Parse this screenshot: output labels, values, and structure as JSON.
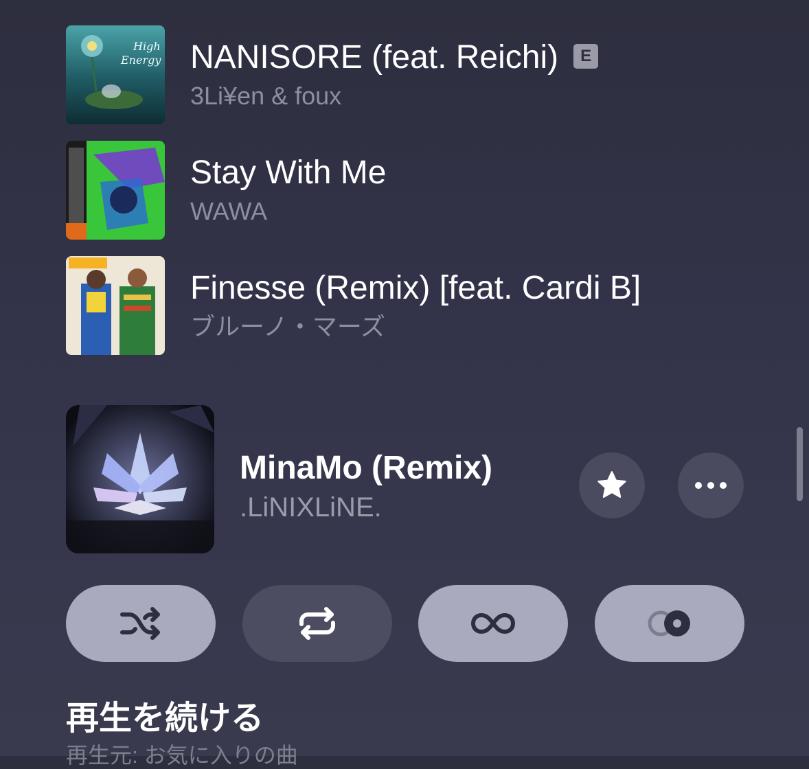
{
  "queue": [
    {
      "title": "NANISORE (feat. Reichi)",
      "artist": "3Li¥en & foux",
      "explicit": "E",
      "art_colors": [
        "#1f5a63",
        "#2d7b5a"
      ]
    },
    {
      "title": "Stay With Me",
      "artist": "WAWA",
      "explicit": "",
      "art_colors": [
        "#39c63a",
        "#7a35d6"
      ]
    },
    {
      "title": "Finesse (Remix) [feat. Cardi B]",
      "artist": "ブルーノ・マーズ",
      "explicit": "",
      "art_colors": [
        "#e9e1d1",
        "#d94b30"
      ]
    }
  ],
  "now_playing": {
    "title": "MinaMo (Remix)",
    "artist": ".LiNIXLiNE.",
    "favorite_icon": "star-icon",
    "more_icon": "ellipsis-icon"
  },
  "controls": [
    {
      "name": "shuffle",
      "icon": "shuffle-icon",
      "active": true
    },
    {
      "name": "repeat",
      "icon": "repeat-icon",
      "active": false
    },
    {
      "name": "autoplay",
      "icon": "infinity-icon",
      "active": true
    },
    {
      "name": "crossfade",
      "icon": "crossfade-icon",
      "active": true
    }
  ],
  "section": {
    "title": "再生を続ける",
    "subtitle": "再生元: お気に入りの曲"
  },
  "colors": {
    "background": "#2d2e3e",
    "secondary_text": "#8d8e9f",
    "pill_active": "#a9aabe",
    "pill_inactive": "#4c4d61",
    "circle_button": "#4a4b5e"
  }
}
